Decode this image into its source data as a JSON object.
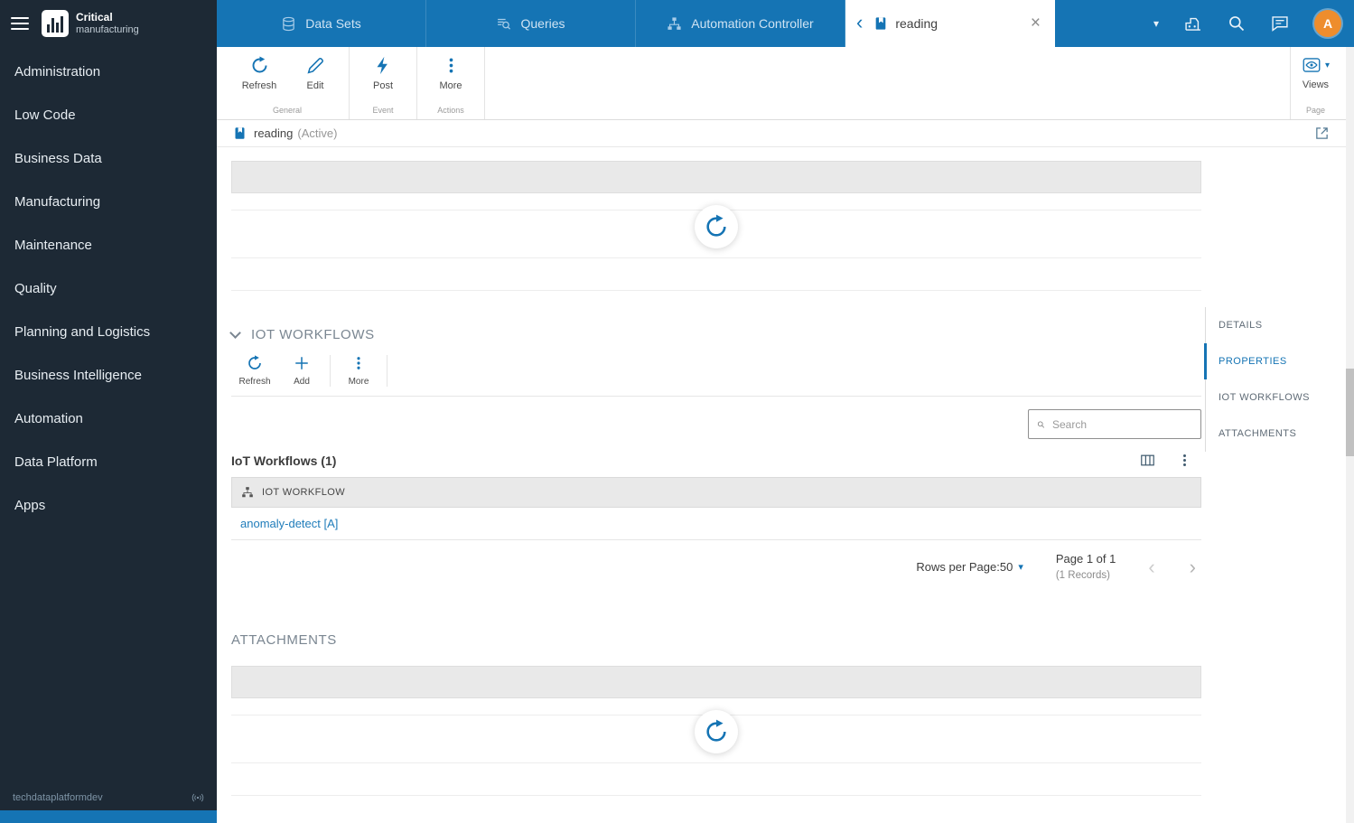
{
  "icons": {
    "caret_down": "▾",
    "chevron_back": "‹",
    "close": "×",
    "page_prev": "‹",
    "page_next": "›"
  },
  "sidebar": {
    "brand_bold": "Critical",
    "brand_light": "manufacturing",
    "items": [
      {
        "label": "Administration"
      },
      {
        "label": "Low Code"
      },
      {
        "label": "Business Data"
      },
      {
        "label": "Manufacturing"
      },
      {
        "label": "Maintenance"
      },
      {
        "label": "Quality"
      },
      {
        "label": "Planning and Logistics"
      },
      {
        "label": "Business Intelligence"
      },
      {
        "label": "Automation"
      },
      {
        "label": "Data Platform"
      },
      {
        "label": "Apps"
      }
    ],
    "footer_env": "techdataplatformdev"
  },
  "topbar": {
    "tabs": [
      {
        "label": "Data Sets"
      },
      {
        "label": "Queries"
      },
      {
        "label": "Automation Controller"
      }
    ],
    "active_tab": {
      "label": "reading"
    },
    "avatar_initial": "A"
  },
  "ribbon": {
    "refresh": "Refresh",
    "edit": "Edit",
    "post": "Post",
    "more": "More",
    "views": "Views",
    "group_general": "General",
    "group_event": "Event",
    "group_actions": "Actions",
    "group_page": "Page"
  },
  "breadcrumb": {
    "title": "reading",
    "status": "(Active)"
  },
  "iot": {
    "section_title": "IOT WORKFLOWS",
    "toolbar": {
      "refresh": "Refresh",
      "add": "Add",
      "more": "More"
    },
    "search_placeholder": "Search",
    "table_title": "IoT Workflows (1)",
    "column_header": "IOT WORKFLOW",
    "rows": [
      {
        "name": "anomaly-detect [A]"
      }
    ],
    "pagination": {
      "rows_per_page": "Rows per Page:50",
      "page": "Page 1 of 1",
      "records": "(1 Records)"
    }
  },
  "attachments": {
    "section_title": "ATTACHMENTS"
  },
  "rail": {
    "items": [
      {
        "label": "DETAILS"
      },
      {
        "label": "PROPERTIES"
      },
      {
        "label": "IOT WORKFLOWS"
      },
      {
        "label": "ATTACHMENTS"
      }
    ]
  },
  "colors": {
    "accent": "#1574b4",
    "link": "#1f7cba",
    "avatar": "#ee8d2d",
    "sidebar_bg": "#1d2935"
  }
}
